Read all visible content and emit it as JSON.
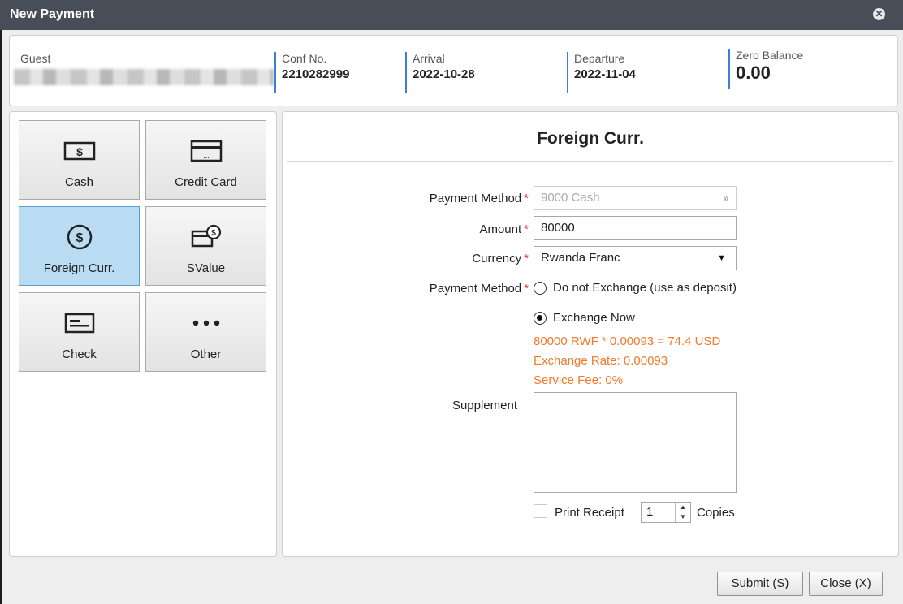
{
  "window": {
    "title": "New Payment"
  },
  "header": {
    "guest_label": "Guest",
    "conf_label": "Conf No.",
    "conf_value": "2210282999",
    "arrival_label": "Arrival",
    "arrival_value": "2022-10-28",
    "departure_label": "Departure",
    "departure_value": "2022-11-04",
    "balance_label": "Zero Balance",
    "balance_value": "0.00"
  },
  "methods": [
    {
      "label": "Cash",
      "icon": "cash-icon",
      "active": false
    },
    {
      "label": "Credit Card",
      "icon": "credit-card-icon",
      "active": false
    },
    {
      "label": "Foreign Curr.",
      "icon": "dollar-coin-icon",
      "active": true
    },
    {
      "label": "SValue",
      "icon": "stored-value-icon",
      "active": false
    },
    {
      "label": "Check",
      "icon": "check-icon",
      "active": false
    },
    {
      "label": "Other",
      "icon": "more-dots-icon",
      "active": false
    }
  ],
  "form": {
    "title": "Foreign Curr.",
    "payment_method_label": "Payment Method",
    "payment_method_value": "9000 Cash",
    "amount_label": "Amount",
    "amount_value": "80000",
    "currency_label": "Currency",
    "currency_value": "Rwanda Franc",
    "exchange_label": "Payment Method",
    "radio_no_exchange": "Do not Exchange (use as deposit)",
    "radio_exchange_now": "Exchange Now",
    "selected_radio": "exchange_now",
    "calc_line": "80000 RWF * 0.00093 = 74.4 USD",
    "rate_line": "Exchange Rate: 0.00093",
    "fee_line": "Service Fee: 0%",
    "supplement_label": "Supplement",
    "print_receipt_label": "Print Receipt",
    "copies_value": "1",
    "copies_label": "Copies"
  },
  "footer": {
    "submit_label": "Submit (S)",
    "close_label": "Close (X)"
  },
  "colors": {
    "accent": "#3c7fd6",
    "active_tile": "#b9dcf3",
    "info_text": "#f07a2a",
    "required": "#e0302a",
    "titlebar": "#474e58"
  }
}
